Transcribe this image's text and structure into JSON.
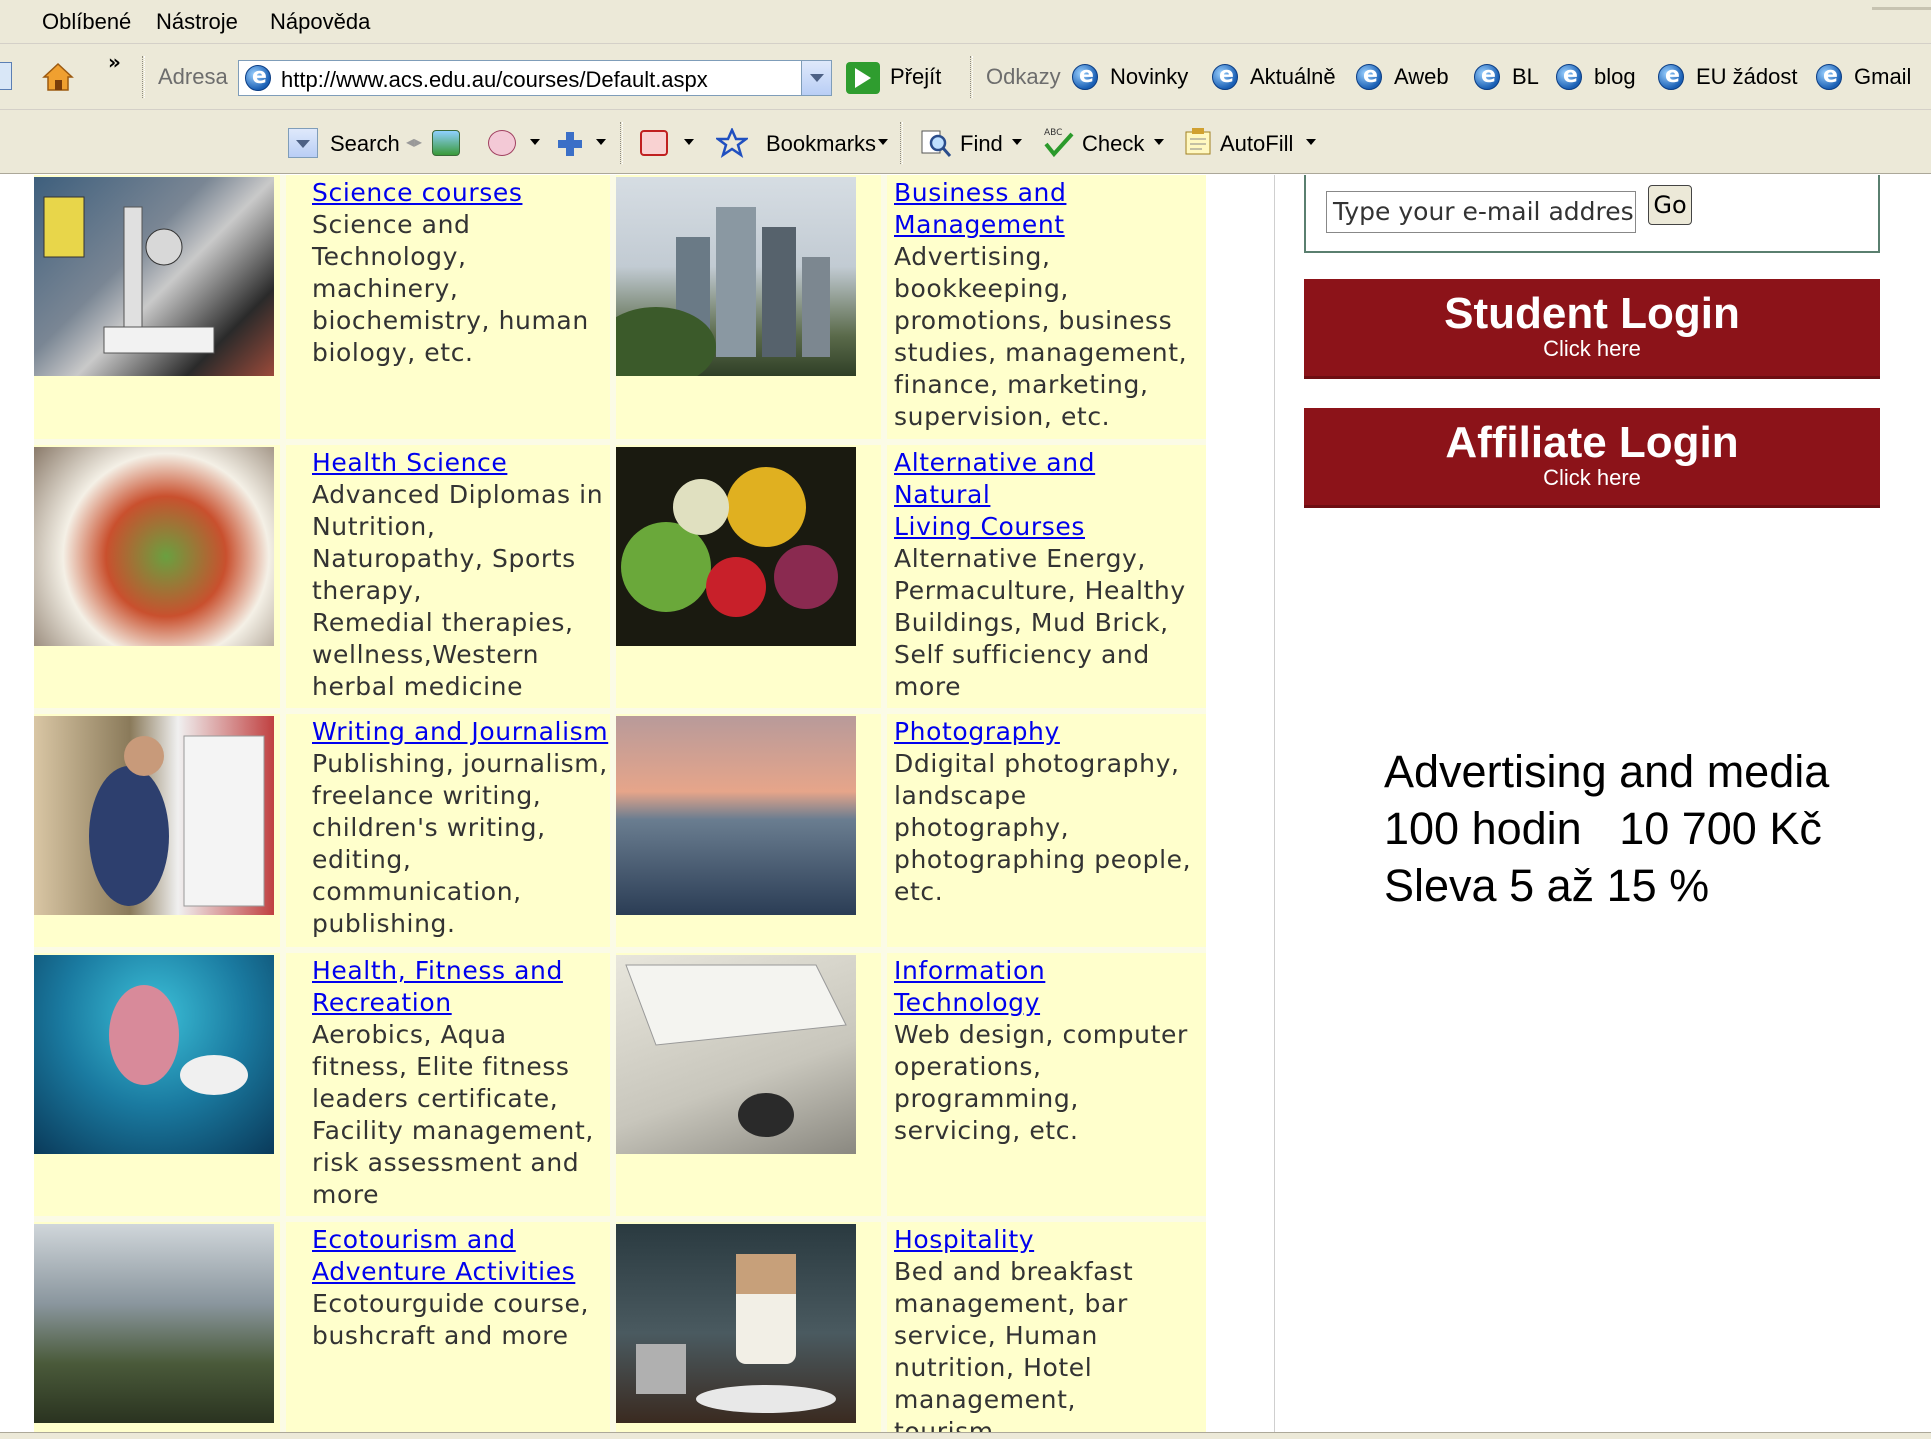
{
  "menu": [
    "Oblíbené",
    "Nástroje",
    "Nápověda"
  ],
  "address_bar": {
    "label": "Adresa",
    "url": "http://www.acs.edu.au/courses/Default.aspx",
    "go_label": "Přejít",
    "links_label": "Odkazy",
    "links": [
      "Novinky",
      "Aktuálně",
      "Aweb",
      "BL",
      "blog",
      "EU žádost",
      "Gmail"
    ]
  },
  "toolbar": {
    "search": "Search",
    "bookmarks": "Bookmarks",
    "find": "Find",
    "check": "Check",
    "autofill": "AutoFill"
  },
  "courses": [
    {
      "title": "Science courses",
      "description": "Science and\nTechnology,\nmachinery,\nbiochemistry, human\nbiology, etc."
    },
    {
      "title": "Business and\nManagement",
      "description": "Advertising,\nbookkeeping,\npromotions, business\nstudies, management,\nfinance, marketing,\nsupervision, etc."
    },
    {
      "title": "Health Science",
      "description": "Advanced Diplomas in\nNutrition,\nNaturopathy, Sports\ntherapy,\nRemedial therapies,\nwellness,Western\nherbal medicine"
    },
    {
      "title": "Alternative and Natural\nLiving Courses",
      "description": "Alternative Energy,\nPermaculture, Healthy\nBuildings, Mud Brick,\nSelf sufficiency and\nmore"
    },
    {
      "title": "Writing and Journalism",
      "description": "Publishing, journalism,\nfreelance writing,\nchildren's writing,\nediting,\ncommunication,\npublishing."
    },
    {
      "title": "Photography",
      "description": "Ddigital photography,\nlandscape\nphotography,\nphotographing people,\netc."
    },
    {
      "title": "Health, Fitness and\nRecreation",
      "description": "Aerobics, Aqua\nfitness, Elite fitness\nleaders certificate,\nFacility management,\nrisk assessment and\nmore"
    },
    {
      "title": "Information\nTechnology",
      "description": "Web design, computer\noperations,\nprogramming,\nservicing, etc."
    },
    {
      "title": "Ecotourism and\nAdventure Activities",
      "description": "Ecotourguide course,\nbushcraft and more"
    },
    {
      "title": "Hospitality",
      "description": "Bed and breakfast\nmanagement, bar\nservice, Human\nnutrition, Hotel\nmanagement,\ntourism"
    }
  ],
  "newsletter": {
    "input_value": "Type your e-mail address",
    "go_label": "Go"
  },
  "student_login": {
    "title": "Student Login",
    "subtitle": "Click here"
  },
  "affiliate_login": {
    "title": "Affiliate Login",
    "subtitle": "Click here"
  },
  "note": {
    "line1": "Advertising and media",
    "line2": "100 hodin   10 700 Kč",
    "line3": "Sleva 5 až 15 %"
  },
  "colors": {
    "grid_bg": "#ffffcc",
    "link": "#0000ee",
    "login_bg": "#8c1319"
  }
}
